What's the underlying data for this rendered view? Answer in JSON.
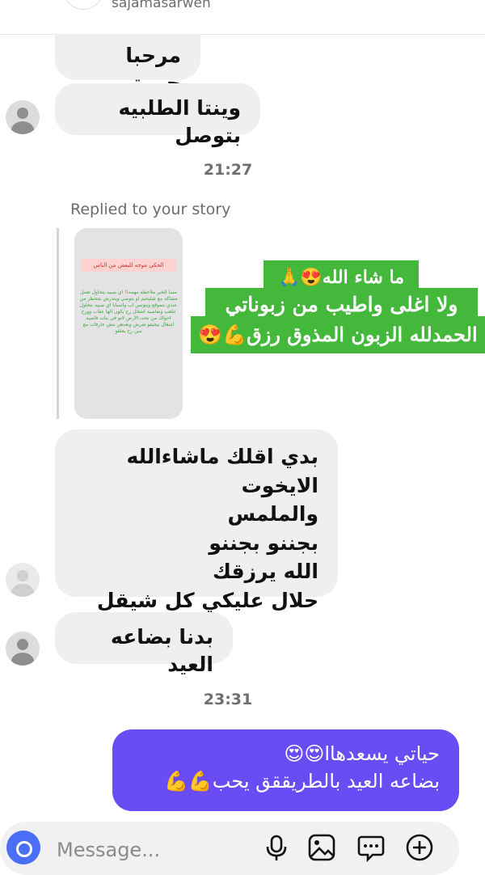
{
  "header": {
    "username": "sajamasarwen"
  },
  "messages": {
    "m1": "مرحبا حبيبتي",
    "m2": "وينتا الطلبيه بتوصل",
    "time1": "21:27",
    "replied_label": "Replied to your story",
    "story": {
      "tag": "الحكي موجه للبعض من الناس",
      "body": "مسا الخير ملاحظه مهمه!! اي صبيه بتحاول تعمل مشاكه مع شليحيم او بتوصي ويتدرش بتتحظر من عندي بتموقع وبتوتس اب واتسانا اي صبيه بتحاول تتلعب وتفاصيه اشغال رح يكون الها عقاب وورح احولك من تحت الارض لانو في بنات فاضيه اشغال بيخيفو شرش وبعدهن مش عارفات مع مين رح يعلقو"
    },
    "sticker": {
      "line1": "ما شاء الله😍🙏",
      "line2": "ولا اغلى واطيب من زبوناتي",
      "line3": "الحمدلله الزبون المذوق رزق💪😍"
    },
    "m3": [
      "بدي اقلك ماشاءالله الايخوت",
      "والملمس",
      "بجننو بجننو",
      "الله يرزقك",
      "حلال عليكي كل شيقل"
    ],
    "m4": "بدنا بضاعه العيد",
    "time2": "23:31",
    "outgoing": [
      "حياتي يسعدهاا😍😍",
      "بضاعه العيد بالطريققق يحب💪💪"
    ]
  },
  "composer": {
    "placeholder": "Message..."
  },
  "colors": {
    "accent": "#6a4cf5",
    "sticker": "#43b83b",
    "incoming": "#efeff1",
    "camera": "#4a6ef5"
  },
  "icons": [
    "camera-icon",
    "microphone-icon",
    "gallery-icon",
    "sticker-icon",
    "plus-icon"
  ]
}
